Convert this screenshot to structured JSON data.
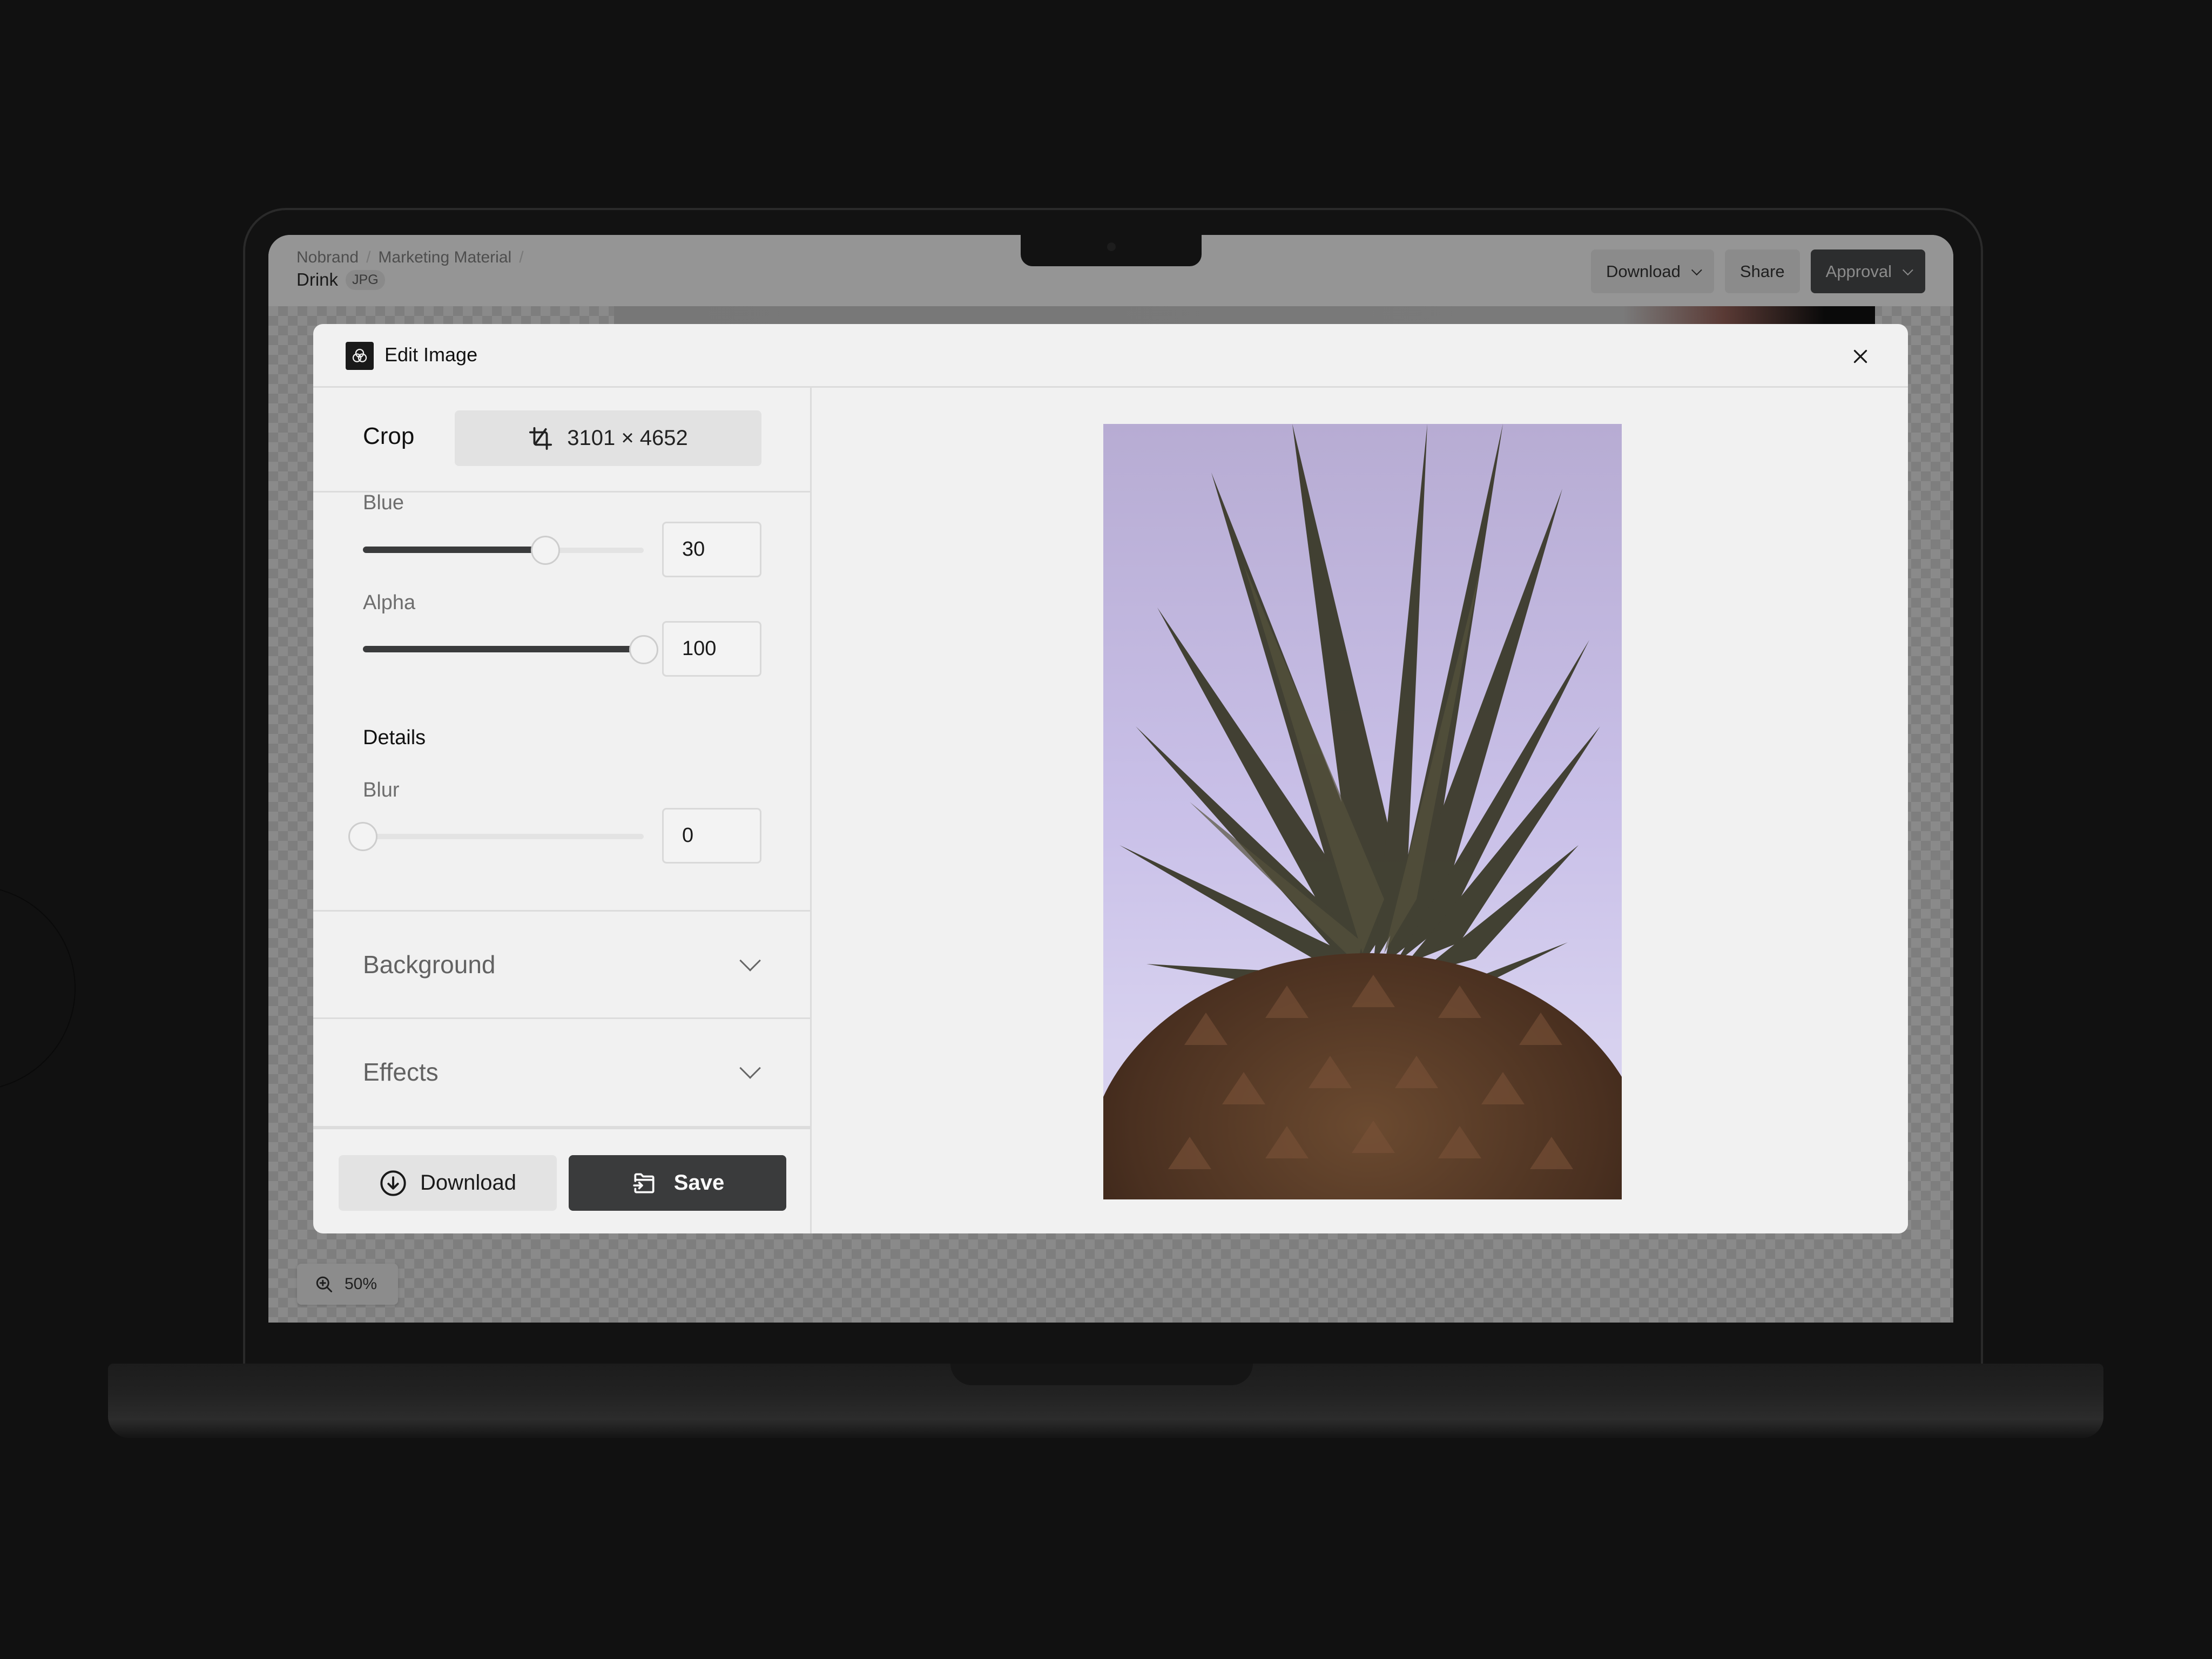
{
  "header": {
    "breadcrumb": [
      "Nobrand",
      "Marketing Material"
    ],
    "breadcrumb_separator": "/",
    "file_name": "Drink",
    "file_type": "JPG",
    "actions": {
      "download_label": "Download",
      "share_label": "Share",
      "approval_label": "Approval"
    }
  },
  "modal": {
    "title": "Edit Image",
    "logo_icon": "three-circles-icon",
    "close_icon": "close-icon",
    "crop": {
      "label": "Crop",
      "dimensions": "3101 × 4652",
      "icon": "crop-icon"
    },
    "controls": {
      "blue": {
        "label": "Blue",
        "value": "30",
        "fraction": 0.65
      },
      "alpha": {
        "label": "Alpha",
        "value": "100",
        "fraction": 1.0
      },
      "details_title": "Details",
      "blur": {
        "label": "Blur",
        "value": "0",
        "fraction": 0.0
      }
    },
    "accordions": [
      {
        "label": "Background",
        "expanded": false
      },
      {
        "label": "Effects",
        "expanded": false
      }
    ],
    "footer": {
      "download_label": "Download",
      "save_label": "Save"
    },
    "preview": {
      "subject": "pineapple photo on lavender background"
    }
  },
  "zoom": {
    "value": "50%",
    "icon": "zoom-in-icon"
  },
  "colors": {
    "primary_dark": "#3a3b3c",
    "panel_bg": "#f1f1f1",
    "divider": "#dcdcdc",
    "device_bg": "#111111",
    "preview_bg_lavender": "#c9c0e8"
  }
}
